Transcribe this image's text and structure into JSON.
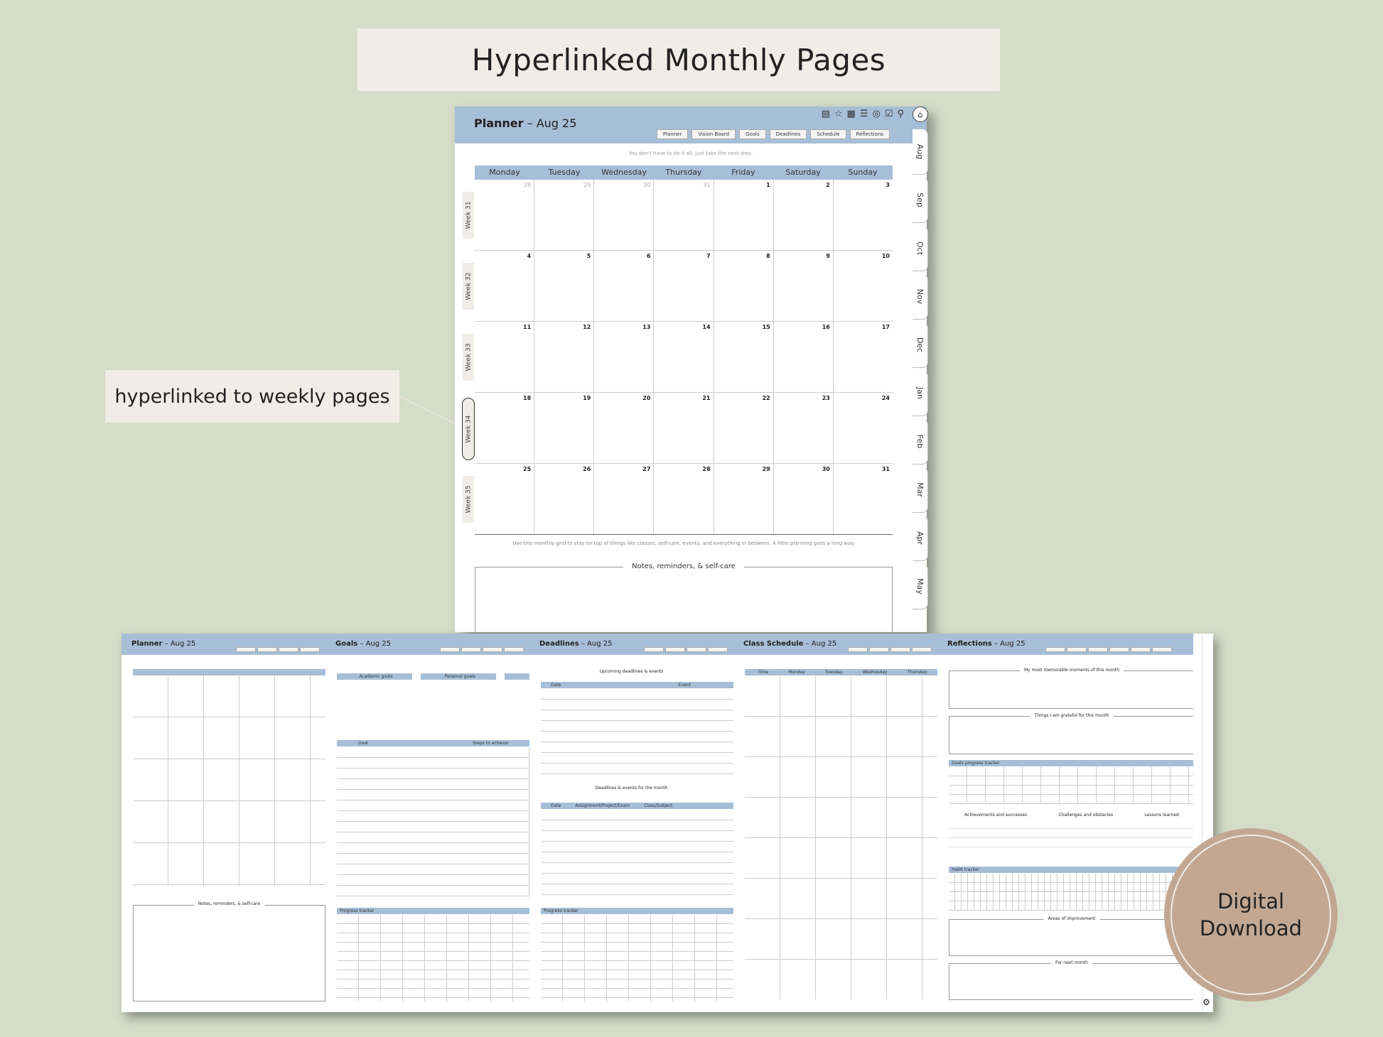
{
  "banner": {
    "title": "Hyperlinked Monthly Pages"
  },
  "callout": {
    "text": "hyperlinked to weekly pages"
  },
  "planner": {
    "title_bold": "Planner",
    "title_rest": " – Aug 25",
    "nav": [
      "Planner",
      "Vision Board",
      "Goals",
      "Deadlines",
      "Schedule",
      "Reflections"
    ],
    "quote": "You don't have to do it all, just take the next step.",
    "days": [
      "Monday",
      "Tuesday",
      "Wednesday",
      "Thursday",
      "Friday",
      "Saturday",
      "Sunday"
    ],
    "weeks": [
      "Week 31",
      "Week 32",
      "Week 33",
      "Week 34",
      "Week 35"
    ],
    "dates": [
      [
        "28",
        "29",
        "30",
        "31",
        "1",
        "2",
        "3"
      ],
      [
        "4",
        "5",
        "6",
        "7",
        "8",
        "9",
        "10"
      ],
      [
        "11",
        "12",
        "13",
        "14",
        "15",
        "16",
        "17"
      ],
      [
        "18",
        "19",
        "20",
        "21",
        "22",
        "23",
        "24"
      ],
      [
        "25",
        "26",
        "27",
        "28",
        "29",
        "30",
        "31"
      ]
    ],
    "caption": "Use this monthly grid to stay on top of things like classes, self-care, events, and everything in between. A little planning goes a long way.",
    "notes_label": "Notes, reminders, & self-care"
  },
  "month_tabs": [
    "Aug",
    "Sep",
    "Oct",
    "Nov",
    "Dec",
    "Jan",
    "Feb",
    "Mar",
    "Apr",
    "May"
  ],
  "thumbs": {
    "planner": {
      "bold": "Planner",
      "rest": " – Aug 25",
      "notes": "Notes, reminders, & self-care"
    },
    "goals": {
      "bold": "Goals",
      "rest": " – Aug 25",
      "c1": "Academic goals",
      "c2": "Personal goals",
      "goal": "Goal",
      "steps": "Steps to achieve",
      "progress": "Progress tracker"
    },
    "deadlines": {
      "bold": "Deadlines",
      "rest": " – Aug 25",
      "up": "Upcoming deadlines & events",
      "date": "Date",
      "event": "Event",
      "month": "Deadlines & events for the month",
      "assign": "Assignment/Project/Exam",
      "cls": "Class/Subject",
      "progress": "Progress tracker"
    },
    "schedule": {
      "bold": "Class Schedule",
      "rest": " – Aug 25",
      "time": "Time",
      "mon": "Monday",
      "tue": "Tuesday",
      "wed": "Wednesday",
      "thu": "Thursday"
    },
    "reflections": {
      "bold": "Reflections",
      "rest": " – Aug 25",
      "memorable": "My most memorable moments of this month",
      "grateful": "Things I am grateful for this month",
      "goals": "Goals progress tracker",
      "ach": "Achievements and successes",
      "chal": "Challenges and obstacles",
      "less": "Lessons learned",
      "habit": "Habit tracker",
      "areas": "Areas of improvement",
      "next": "For next month"
    }
  },
  "badge": {
    "line1": "Digital",
    "line2": "Download"
  },
  "colors": {
    "background": "#d5dcc8",
    "header": "#a7bed7",
    "panel": "#efede5",
    "badge": "#c2a893"
  }
}
